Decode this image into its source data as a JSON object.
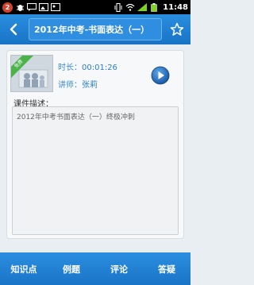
{
  "status_bar": {
    "notification_count": "2",
    "time": "11:48"
  },
  "header": {
    "title": "2012年中考-书面表达（一）"
  },
  "course": {
    "thumbnail_ribbon": "免费",
    "duration_label": "时长：",
    "duration_value": "00:01:26",
    "teacher_label": "讲师：",
    "teacher_value": "张莉",
    "description_label": "课件描述：",
    "description_text": "2012年中考书面表达（一）终极冲刺"
  },
  "tabs": [
    {
      "label": "知识点"
    },
    {
      "label": "例题"
    },
    {
      "label": "评论"
    },
    {
      "label": "答疑"
    }
  ],
  "colors": {
    "primary": "#1f7fd2",
    "ribbon": "#4bb34a",
    "play": "#1c5fb0"
  }
}
